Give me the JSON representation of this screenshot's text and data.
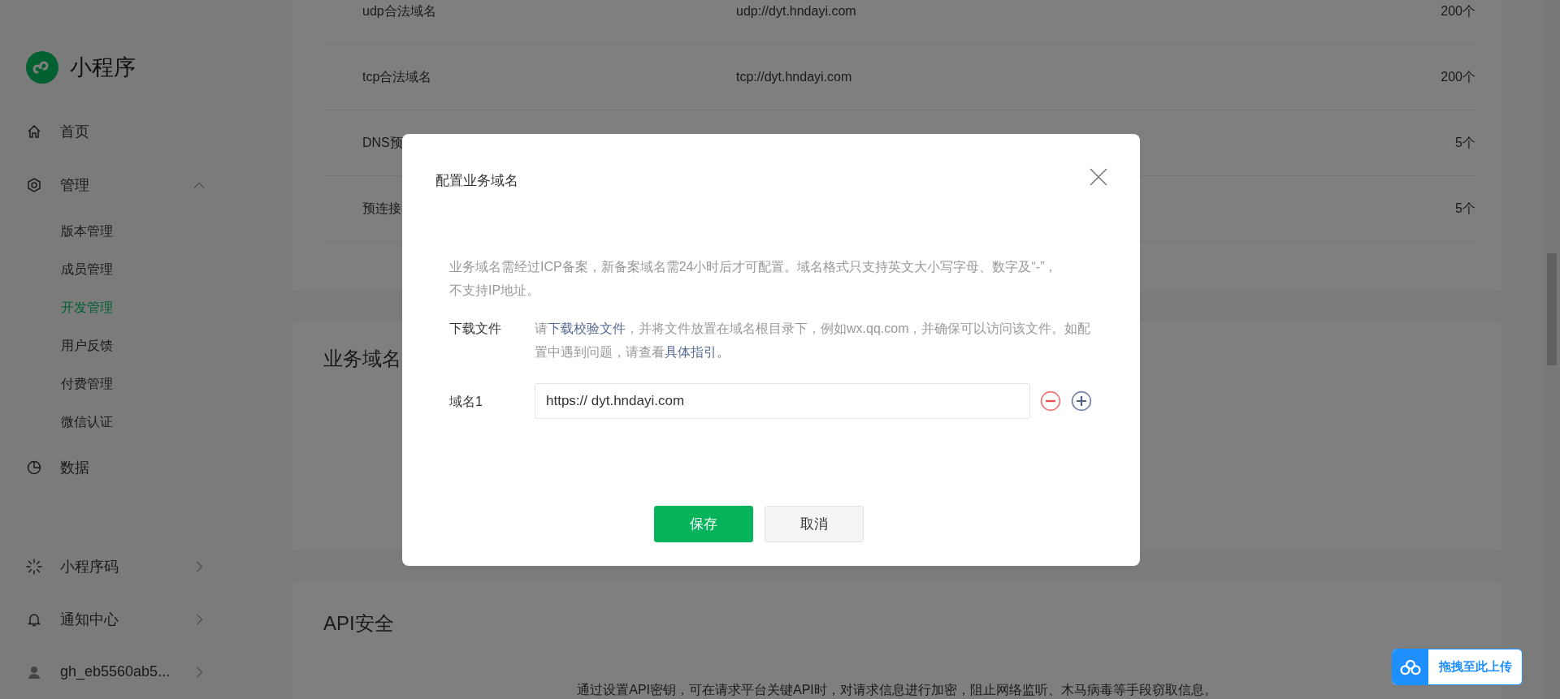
{
  "sidebar": {
    "logo": {
      "title": "小程序"
    },
    "nav": [
      {
        "label": "首页"
      },
      {
        "label": "管理",
        "expanded": true,
        "children": [
          {
            "label": "版本管理",
            "selected": false
          },
          {
            "label": "成员管理",
            "selected": false
          },
          {
            "label": "开发管理",
            "selected": true
          },
          {
            "label": "用户反馈",
            "selected": false
          },
          {
            "label": "付费管理",
            "selected": false
          },
          {
            "label": "微信认证",
            "selected": false
          }
        ]
      },
      {
        "label": "数据"
      }
    ],
    "bottom": [
      {
        "label": "小程序码",
        "expanded": false
      },
      {
        "label": "通知中心",
        "expanded": false
      },
      {
        "label": "gh_eb5560ab5...",
        "expanded": false
      }
    ]
  },
  "server_domains": {
    "rows": [
      {
        "name": "udp合法域名",
        "value": "udp://dyt.hndayi.com",
        "limit": "200个"
      },
      {
        "name": "tcp合法域名",
        "value": "tcp://dyt.hndayi.com",
        "limit": "200个"
      },
      {
        "name": "DNS预",
        "limit": "5个"
      },
      {
        "name": "预连接",
        "limit": "5个"
      }
    ]
  },
  "business_domain": {
    "title": "业务域名"
  },
  "api_security": {
    "title": "API安全",
    "description": "通过设置API密钥，可在请求平台关键API时，对请求信息进行加密，阻止网络监听、木马病毒等手段窃取信息。"
  },
  "dialog": {
    "title": "配置业务域名",
    "notice": "业务域名需经过ICP备案，新备案域名需24小时后才可配置。域名格式只支持英文大小写字母、数字及“-”，不支持IP地址。",
    "download": {
      "label": "下载文件",
      "parts": [
        {
          "kind": "text",
          "text": "请"
        },
        {
          "kind": "link",
          "text": "下载校验文件"
        },
        {
          "kind": "text",
          "text": "，并将文件放置在域名根目录下，例如wx.qq.com，并确保可以访问该文件。如配置中遇到问题，请查看"
        },
        {
          "kind": "link",
          "text": "具体指引。"
        }
      ]
    },
    "domains": [
      {
        "label": "域名1",
        "value": "https:// dyt.hndayi.com"
      }
    ],
    "buttons": [
      {
        "kind": "primary",
        "label": "保存"
      },
      {
        "kind": "default",
        "label": "取消"
      }
    ]
  },
  "upload_badge": {
    "label": "拖拽至此上传"
  }
}
